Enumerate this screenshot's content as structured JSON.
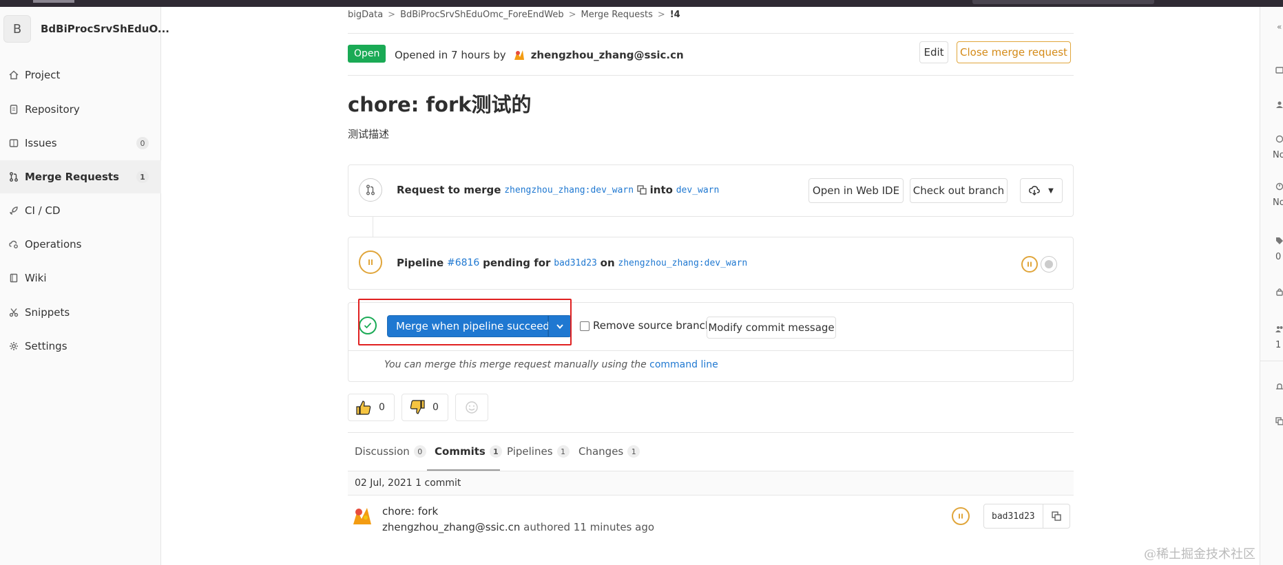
{
  "sidebar": {
    "avatar_letter": "B",
    "project_name": "BdBiProcSrvShEduO...",
    "items": [
      {
        "label": "Project",
        "icon": "home-icon"
      },
      {
        "label": "Repository",
        "icon": "doc-icon"
      },
      {
        "label": "Issues",
        "icon": "issues-icon",
        "count": "0"
      },
      {
        "label": "Merge Requests",
        "icon": "merge-request-icon",
        "count": "1",
        "active": true
      },
      {
        "label": "CI / CD",
        "icon": "rocket-icon"
      },
      {
        "label": "Operations",
        "icon": "cloud-gear-icon"
      },
      {
        "label": "Wiki",
        "icon": "book-icon"
      },
      {
        "label": "Snippets",
        "icon": "scissors-icon"
      },
      {
        "label": "Settings",
        "icon": "gear-icon"
      }
    ]
  },
  "breadcrumb": [
    "bigData",
    "BdBiProcSrvShEduOmc_ForeEndWeb",
    "Merge Requests",
    "!4"
  ],
  "header": {
    "status": "Open",
    "opened_text": "Opened in 7 hours by",
    "author": "zhengzhou_zhang@ssic.cn",
    "edit_label": "Edit",
    "close_label": "Close merge request"
  },
  "mr": {
    "title": "chore: fork测试的",
    "description": "测试描述"
  },
  "request": {
    "prefix": "Request to merge",
    "source": "zhengzhou_zhang:dev_warn",
    "into": "into",
    "target": "dev_warn",
    "web_ide_label": "Open in Web IDE",
    "checkout_label": "Check out branch"
  },
  "pipeline": {
    "prefix": "Pipeline",
    "id": "#6816",
    "status_text": "pending for",
    "sha": "bad31d23",
    "on": "on",
    "ref": "zhengzhou_zhang:dev_warn"
  },
  "merge": {
    "button_label": "Merge when pipeline succeeds",
    "remove_source_label": "Remove source branch",
    "modify_commit_label": "Modify commit message",
    "manual_text": "You can merge this merge request manually using the",
    "command_line_link": "command line"
  },
  "awards": {
    "thumbs_up": "0",
    "thumbs_down": "0"
  },
  "tabs": [
    {
      "label": "Discussion",
      "count": "0"
    },
    {
      "label": "Commits",
      "count": "1",
      "active": true
    },
    {
      "label": "Pipelines",
      "count": "1"
    },
    {
      "label": "Changes",
      "count": "1"
    }
  ],
  "commits": {
    "date_header": "02 Jul, 2021 1 commit",
    "title": "chore: fork",
    "author": "zhengzhou_zhang@ssic.cn",
    "authored": "authored",
    "time": "11 minutes ago",
    "sha": "bad31d23"
  },
  "rightrail": {
    "label_1": "No",
    "label_2": "No",
    "label_3": "0",
    "label_4": "1"
  },
  "watermark": "@稀土掘金技术社区",
  "colors": {
    "open_green": "#1aaa55",
    "link_blue": "#1f78d1",
    "warning_orange": "#e0a53a",
    "highlight_red": "#e02020"
  }
}
